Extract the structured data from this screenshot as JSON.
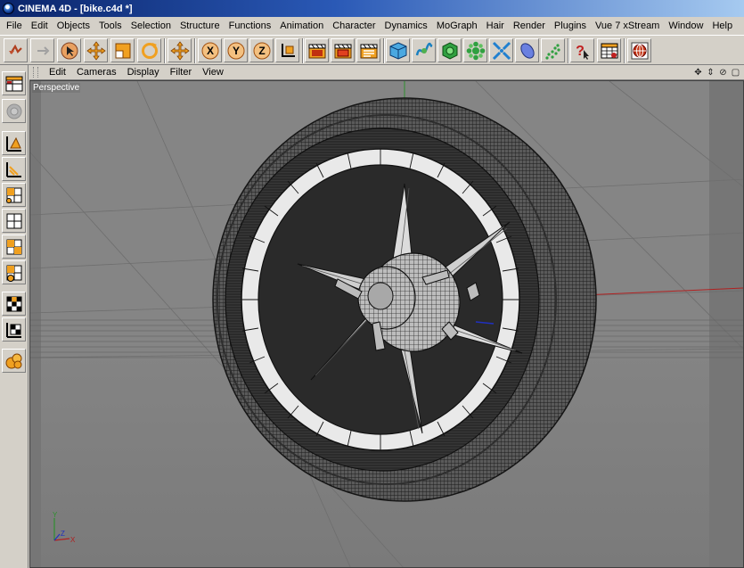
{
  "window": {
    "title": "CINEMA 4D - [bike.c4d *]"
  },
  "menubar": {
    "items": [
      "File",
      "Edit",
      "Objects",
      "Tools",
      "Selection",
      "Structure",
      "Functions",
      "Animation",
      "Character",
      "Dynamics",
      "MoGraph",
      "Hair",
      "Render",
      "Plugins",
      "Vue 7 xStream",
      "Window",
      "Help"
    ]
  },
  "toolbar": {
    "buttons": [
      {
        "name": "undo-icon"
      },
      {
        "name": "redo-icon"
      },
      {
        "name": "live-selection-icon"
      },
      {
        "name": "move-icon"
      },
      {
        "name": "scale-icon"
      },
      {
        "name": "rotate-icon"
      },
      {
        "name": "move-tool-icon"
      },
      {
        "name": "x-axis-icon",
        "label": "X"
      },
      {
        "name": "y-axis-icon",
        "label": "Y"
      },
      {
        "name": "z-axis-icon",
        "label": "Z"
      },
      {
        "name": "world-coordinate-icon"
      },
      {
        "name": "render-view-icon"
      },
      {
        "name": "render-picture-viewer-icon"
      },
      {
        "name": "render-settings-icon"
      },
      {
        "name": "cube-primitive-icon"
      },
      {
        "name": "spline-icon"
      },
      {
        "name": "nurbs-icon"
      },
      {
        "name": "array-icon"
      },
      {
        "name": "deformer-icon"
      },
      {
        "name": "scene-object-icon"
      },
      {
        "name": "particles-icon"
      },
      {
        "name": "help-icon"
      },
      {
        "name": "timeline-icon"
      },
      {
        "name": "web-icon"
      }
    ]
  },
  "viewport_menu": {
    "items": [
      "Edit",
      "Cameras",
      "Display",
      "Filter",
      "View"
    ]
  },
  "viewport": {
    "label": "Perspective",
    "axis_labels": {
      "x": "X",
      "y": "Y",
      "z": "Z"
    }
  },
  "colors": {
    "accent": "#f0a020",
    "titlebar": "#0a246a",
    "viewport_bg": "#7f7f7f"
  }
}
